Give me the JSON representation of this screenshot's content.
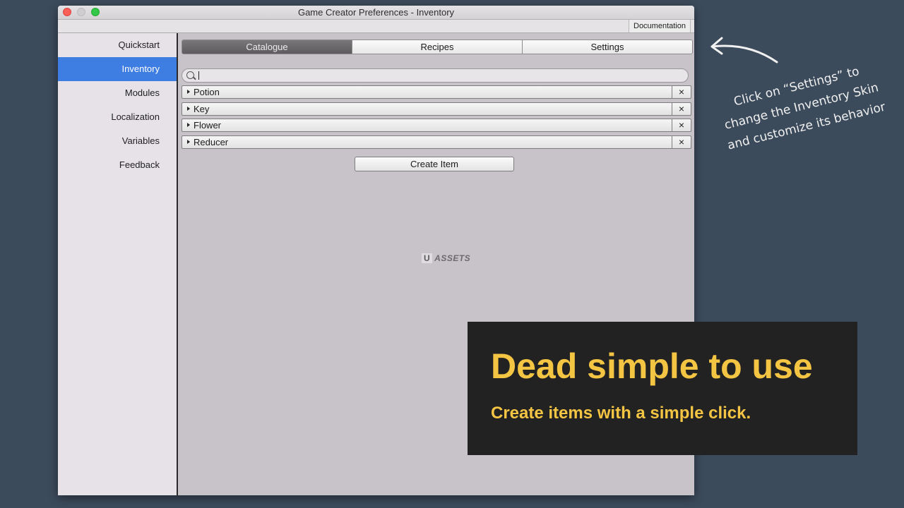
{
  "window": {
    "title": "Game Creator Preferences - Inventory",
    "documentation_label": "Documentation"
  },
  "sidebar": {
    "items": [
      {
        "label": "Quickstart",
        "active": false
      },
      {
        "label": "Inventory",
        "active": true
      },
      {
        "label": "Modules",
        "active": false
      },
      {
        "label": "Localization",
        "active": false
      },
      {
        "label": "Variables",
        "active": false
      },
      {
        "label": "Feedback",
        "active": false
      }
    ]
  },
  "tabs": [
    {
      "label": "Catalogue",
      "active": true
    },
    {
      "label": "Recipes",
      "active": false
    },
    {
      "label": "Settings",
      "active": false
    }
  ],
  "search": {
    "value": "",
    "placeholder": ""
  },
  "items": [
    {
      "label": "Potion",
      "delete": "×"
    },
    {
      "label": "Key",
      "delete": "×"
    },
    {
      "label": "Flower",
      "delete": "×"
    },
    {
      "label": "Reducer",
      "delete": "×"
    }
  ],
  "create_item_label": "Create Item",
  "watermark": {
    "u": "U",
    "text": "ASSETS"
  },
  "annotation": {
    "line1": "Click on “Settings” to",
    "line2": "change the Inventory Skin",
    "line3": "and customize its behavior"
  },
  "overlay": {
    "title": "Dead simple to use",
    "subtitle": "Create items with a simple click."
  },
  "colors": {
    "background": "#3c4b5b",
    "accent": "#3e7de2",
    "overlay_text": "#f4c443"
  }
}
